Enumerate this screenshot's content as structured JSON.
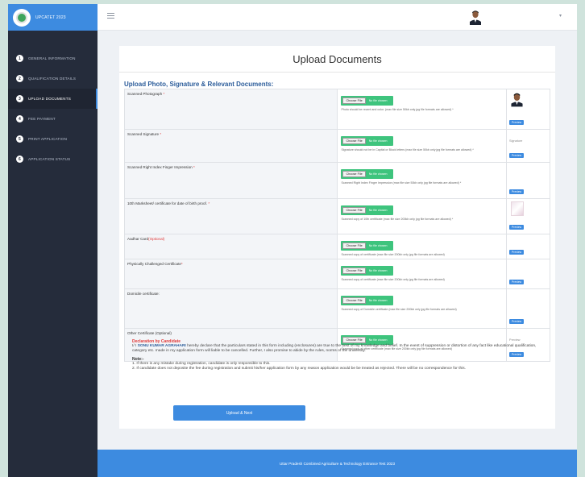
{
  "brand": {
    "title": "UPCATET 2023"
  },
  "nav": [
    {
      "num": "1",
      "label": "GENERAL INFORMATION"
    },
    {
      "num": "2",
      "label": "QUALIFICATION DETAILS"
    },
    {
      "num": "3",
      "label": "UPLOAD DOCUMENTS",
      "active": true
    },
    {
      "num": "4",
      "label": "FEE PAYMENT"
    },
    {
      "num": "5",
      "label": "PRINT APPLICATION"
    },
    {
      "num": "6",
      "label": "APPLICATION STATUS"
    }
  ],
  "page": {
    "title": "Upload Documents",
    "subtitle": "Upload Photo, Signature & Relevant Documents:"
  },
  "file_input": {
    "button": "Choose File",
    "status": "No file chosen"
  },
  "preview_label": "Preview",
  "rows": [
    {
      "label": "Scanned Photograph",
      "req": "*",
      "help": "Photo should be recent and color. (max file size 50kb only jpg file formats are allowed) *"
    },
    {
      "label": "Scanned Signature",
      "req": "*",
      "help": "Signature should not be in Capital or Block letters (max file size 50kb only jpg file formats are allowed) *",
      "preview_alt": "Signature"
    },
    {
      "label": "Scanned Right Index Finger Impression",
      "req": "*",
      "help": "Scanned Right Index Finger Impression (max file size 50kb only jpg file formats are allowed) *"
    },
    {
      "label": "10th Marksheet/ certificate for date of birth proof.",
      "req": "*",
      "help": "Scanned copy of 10th certificate (max file size 200kb only jpg file formats are allowed) *"
    },
    {
      "label": "Aadhar Card",
      "opt": "(Optional)",
      "help": "Scanned copy of certificate (max file size 200kb only jpg file formats are allowed)"
    },
    {
      "label": "Physically Challenged Certificate",
      "req": "*",
      "help": "Scanned copy of certificate (max file size 200kb only jpg file formats are allowed)"
    },
    {
      "label": "Domicile certificate:",
      "help": "Scanned copy of Domicile certificate (max file size 200kb only jpg file formats are allowed)"
    },
    {
      "label": "Other Certificate (Optional)",
      "help": "Scanned copy of other certificate (max file size 200kb only jpg file formats are allowed)",
      "preview_alt": "Preview"
    }
  ],
  "declaration": {
    "title": "Declaration by Candidate",
    "prefix": "I/ I",
    "name": "SONU KUMAR AGRAHARI",
    "text": "hereby declare that the particulars stated in this form including (enclosures) are true to the best of my knowledge and belief. In the event of suppression or distortion of any fact like educational qualification, category etc. made in my application form will liable to be cancelled. Further, I also promise to abide by the rules, norms of the university."
  },
  "note": {
    "title": "Note:-",
    "items": [
      "1. If there is any mistake during registration, candidate is only responsible to this.",
      "2. If candidate does not deposite the fee during registration and submit his/her application form by any reason application would be be treated as rejected. There will be no correspondence for this."
    ]
  },
  "upload_button": "Upload & Next",
  "footer": "Uttar Pradesh Combined Agriculture & Technology Entrance Test 2023",
  "colors": {
    "accent": "#3d8be0",
    "sidebar": "#252c3b",
    "file_green": "#3ec47d",
    "required_red": "#e03a3a"
  }
}
